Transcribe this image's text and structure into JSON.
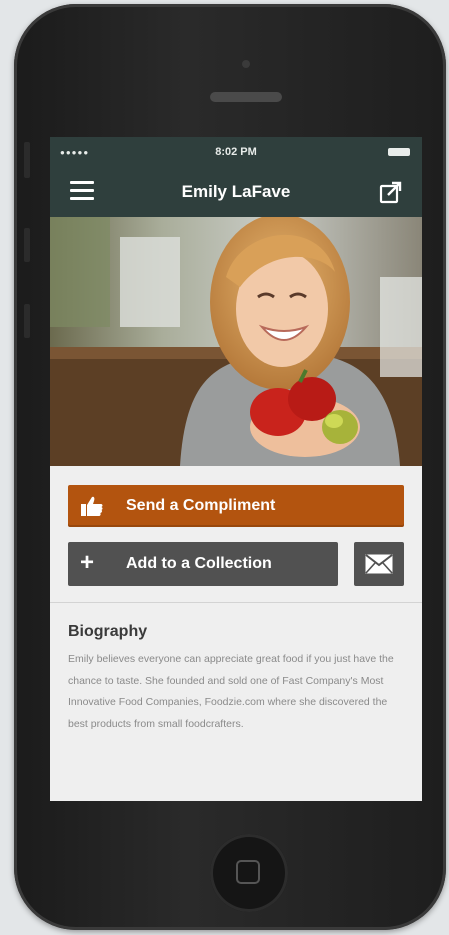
{
  "status_bar": {
    "signal": "●●●●●",
    "time": "8:02 PM"
  },
  "nav": {
    "title": "Emily LaFave"
  },
  "photo": {
    "alt": "Emily LaFave holding red peppers and a tomato"
  },
  "actions": {
    "compliment_label": "Send a Compliment",
    "collection_label": "Add to a Collection",
    "collection_plus": "+"
  },
  "biography": {
    "heading": "Biography",
    "text": "Emily believes everyone can appreciate great food if you just have the chance to taste. She founded and sold one of Fast Company's Most Innovative Food Companies, Foodzie.com where she discovered the best products from small foodcrafters."
  },
  "colors": {
    "nav_bg": "#2f3f3d",
    "compliment_bg": "#b3540f",
    "secondary_btn_bg": "#515151",
    "screen_bg": "#efefef"
  },
  "icons": [
    "menu-icon",
    "share-icon",
    "thumbs-up-icon",
    "plus-icon",
    "mail-icon"
  ]
}
